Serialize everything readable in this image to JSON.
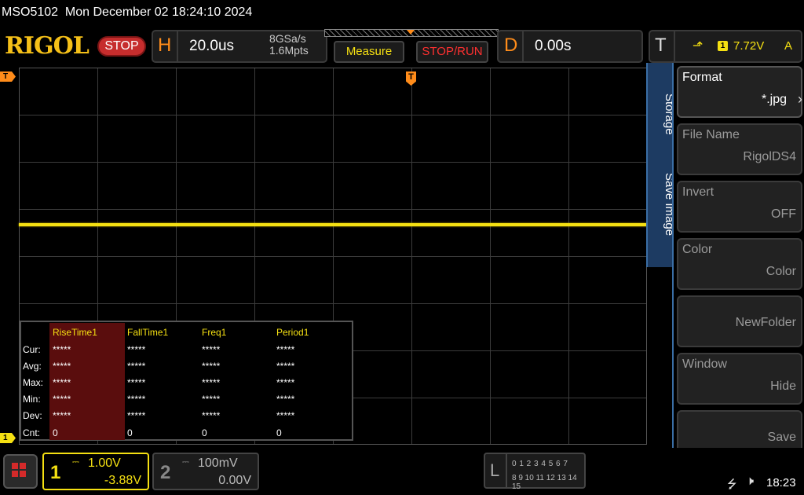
{
  "title_bar": {
    "text": "MSO5102  Mon December 02 18:24:10 2024"
  },
  "header": {
    "logo": "RIGOL",
    "run_status": "STOP",
    "horizontal": {
      "letter": "H",
      "timebase": "20.0us",
      "sample_rate": "8GSa/s",
      "memory_depth": "1.6Mpts"
    },
    "measure_label": "Measure",
    "stop_run_label": "STOP/RUN",
    "delay": {
      "letter": "D",
      "value": "0.00s"
    },
    "trigger": {
      "letter": "T",
      "edge_symbol": "⬏",
      "channel": "1",
      "level": "7.72V",
      "coupling": "A"
    }
  },
  "markers": {
    "trigger_position": "T",
    "trigger_level": "T",
    "ch1_offset": "1"
  },
  "measurements": {
    "headers": [
      "RiseTime1",
      "FallTime1",
      "Freq1",
      "Period1"
    ],
    "rows": [
      {
        "label": "Cur:",
        "values": [
          "*****",
          "*****",
          "*****",
          "*****"
        ]
      },
      {
        "label": "Avg:",
        "values": [
          "*****",
          "*****",
          "*****",
          "*****"
        ]
      },
      {
        "label": "Max:",
        "values": [
          "*****",
          "*****",
          "*****",
          "*****"
        ]
      },
      {
        "label": "Min:",
        "values": [
          "*****",
          "*****",
          "*****",
          "*****"
        ]
      },
      {
        "label": "Dev:",
        "values": [
          "*****",
          "*****",
          "*****",
          "*****"
        ]
      },
      {
        "label": "Cnt:",
        "values": [
          "0",
          "0",
          "0",
          "0"
        ]
      }
    ]
  },
  "side_menu": {
    "tabs": [
      "Storage",
      "Save Image"
    ],
    "items": [
      {
        "title": "Format",
        "value": "*.jpg"
      },
      {
        "title": "File Name",
        "value": "RigolDS4"
      },
      {
        "title": "Invert",
        "value": "OFF"
      },
      {
        "title": "Color",
        "value": "Color"
      },
      {
        "title": "",
        "value": "NewFolder"
      },
      {
        "title": "Window",
        "value": "Hide"
      },
      {
        "title": "",
        "value": "Save"
      }
    ]
  },
  "channels": {
    "ch1": {
      "number": "1",
      "coupling_symbol": "⎓",
      "scale": "1.00V",
      "offset": "-3.88V",
      "color": "#f5e012"
    },
    "ch2": {
      "number": "2",
      "coupling_symbol": "⎓",
      "scale": "100mV",
      "offset": "0.00V"
    }
  },
  "logic": {
    "letter": "L",
    "row1": "0 1 2 3  4 5 6 7",
    "row2": "8 9 10 11 12 13 14 15"
  },
  "status": {
    "usb_icon": "usb-icon",
    "speaker_icon": "speaker-muted-icon",
    "time": "18:23"
  }
}
